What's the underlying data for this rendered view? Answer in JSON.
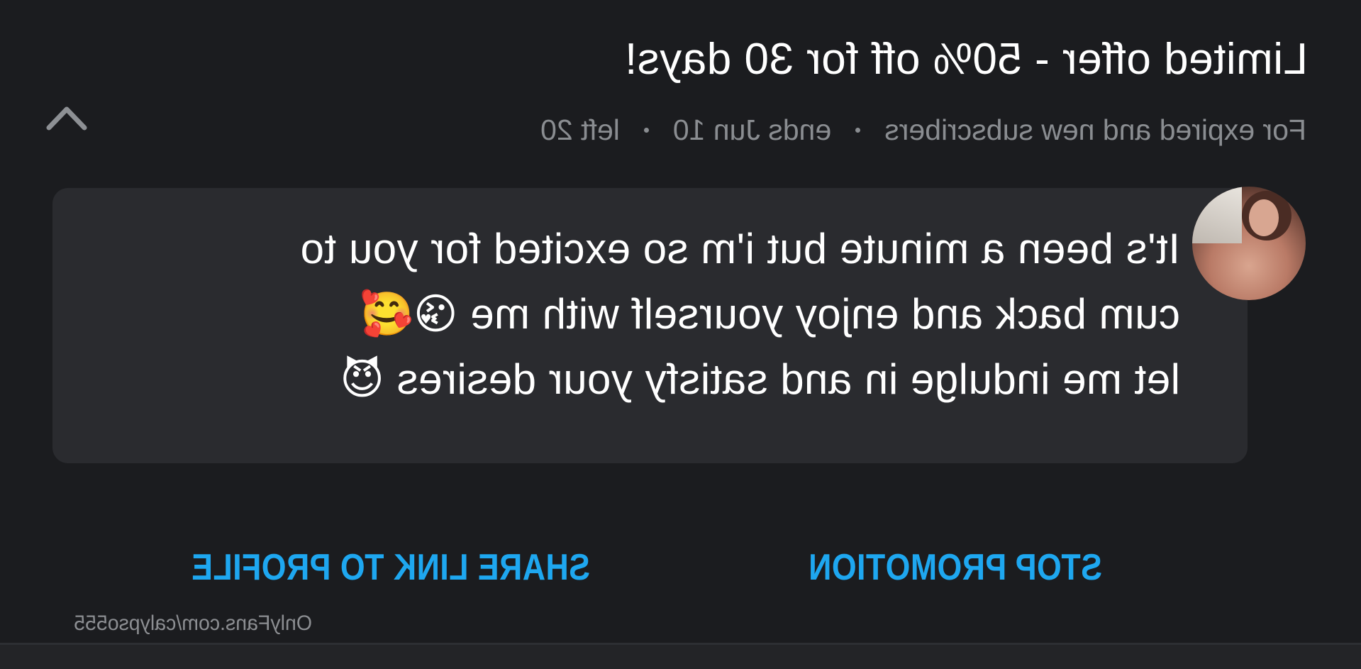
{
  "offer": {
    "title": "Limited offer - 50% off for 30 days!",
    "audience": "For expired and new subscribers",
    "ends": "ends Jun 10",
    "left": "left 20"
  },
  "message": {
    "lines": [
      "It's been a minute but i'm so excited for you to",
      "cum back and enjoy yourself with me 😘🥰",
      "let me indulge in and satisfy your desires 😈"
    ]
  },
  "actions": {
    "stop_label": "STOP PROMOTION",
    "share_label": "SHARE LINK TO PROFILE"
  },
  "watermark": "OnlyFans.com/calypso555",
  "icons": {
    "collapse": "chevron-up-icon",
    "avatar": "avatar-image"
  },
  "colors": {
    "background": "#1b1c1f",
    "bubble": "#2a2b2f",
    "accent": "#1ea7f0",
    "muted_text": "#8a8d91",
    "text": "#ffffff"
  }
}
